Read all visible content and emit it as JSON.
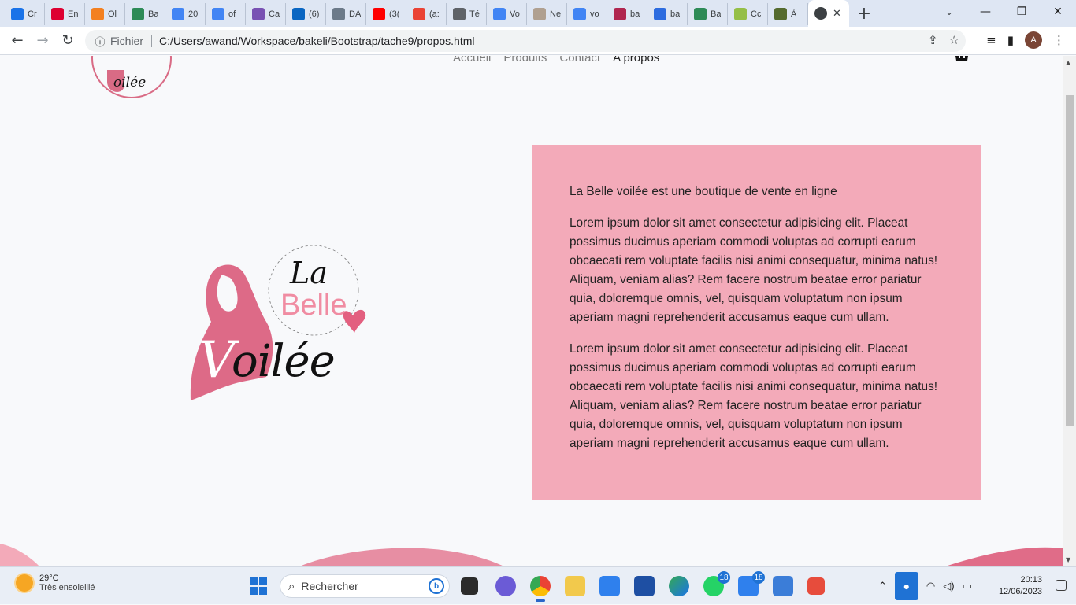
{
  "browser": {
    "tabs": [
      {
        "icon": "chrome-icon",
        "title": "Cr",
        "color": "#1a73e8"
      },
      {
        "icon": "angular-icon",
        "title": "En",
        "color": "#dd0031"
      },
      {
        "icon": "cloud-icon",
        "title": "Ol",
        "color": "#f38020"
      },
      {
        "icon": "bakeli-icon",
        "title": "Ba",
        "color": "#2e8b57"
      },
      {
        "icon": "docs-icon",
        "title": "20",
        "color": "#4285f4"
      },
      {
        "icon": "google-icon",
        "title": "of",
        "color": "#4285f4"
      },
      {
        "icon": "bootstrap-icon",
        "title": "Ca",
        "color": "#7952b3"
      },
      {
        "icon": "linkedin-icon",
        "title": "(6)",
        "color": "#0a66c2"
      },
      {
        "icon": "page-icon",
        "title": "DA",
        "color": "#6c7a89"
      },
      {
        "icon": "youtube-icon",
        "title": "(3(",
        "color": "#ff0000"
      },
      {
        "icon": "gmail-icon",
        "title": "(a:",
        "color": "#ea4335"
      },
      {
        "icon": "graduation-icon",
        "title": "Té",
        "color": "#5f6368"
      },
      {
        "icon": "google-icon",
        "title": "Vo",
        "color": "#4285f4"
      },
      {
        "icon": "notion-icon",
        "title": "Ne",
        "color": "#b0a090"
      },
      {
        "icon": "google-icon",
        "title": "vo",
        "color": "#4285f4"
      },
      {
        "icon": "tag-icon",
        "title": "ba",
        "color": "#b0264f"
      },
      {
        "icon": "wix-icon",
        "title": "ba",
        "color": "#2d6cdf"
      },
      {
        "icon": "bakeli-icon",
        "title": "Ba",
        "color": "#2e8b57"
      },
      {
        "icon": "shopify-icon",
        "title": "Cc",
        "color": "#95bf47"
      },
      {
        "icon": "tahe-icon",
        "title": "À",
        "color": "#556b2f"
      }
    ],
    "active_tab": {
      "icon": "globe-icon",
      "title": "",
      "close": "✕"
    },
    "new_tab": "+",
    "address": {
      "scheme_label": "Fichier",
      "url": "C:/Users/awand/Workspace/bakeli/Bootstrap/tache9/propos.html"
    },
    "profile_initial": "A"
  },
  "site": {
    "logo_small_text": "oilée",
    "nav": [
      {
        "label": "Accueil",
        "current": false
      },
      {
        "label": "Produits",
        "current": false
      },
      {
        "label": "Contact",
        "current": false
      },
      {
        "label": "A propos",
        "current": true
      }
    ],
    "big_logo": {
      "la": "La",
      "belle": "Belle",
      "v": "V",
      "oilee": "oilée"
    },
    "about": {
      "intro": "La Belle voilée est une boutique de vente en ligne",
      "paragraphs": [
        "Lorem ipsum dolor sit amet consectetur adipisicing elit. Placeat possimus ducimus aperiam commodi voluptas ad corrupti earum obcaecati rem voluptate facilis nisi animi consequatur, minima natus! Aliquam, veniam alias? Rem facere nostrum beatae error pariatur quia, doloremque omnis, vel, quisquam voluptatum non ipsum aperiam magni reprehenderit accusamus eaque cum ullam.",
        "Lorem ipsum dolor sit amet consectetur adipisicing elit. Placeat possimus ducimus aperiam commodi voluptas ad corrupti earum obcaecati rem voluptate facilis nisi animi consequatur, minima natus! Aliquam, veniam alias? Rem facere nostrum beatae error pariatur quia, doloremque omnis, vel, quisquam voluptatum non ipsum aperiam magni reprehenderit accusamus eaque cum ullam."
      ]
    },
    "colors": {
      "accent_pink": "#f3aab9",
      "logo_pink": "#d96b85",
      "belle_pink": "#f08ca2"
    }
  },
  "taskbar": {
    "weather": {
      "temp": "29°C",
      "desc": "Très ensoleillé"
    },
    "search_placeholder": "Rechercher",
    "whatsapp_badge": "18",
    "mail_badge": "18",
    "time": "20:13",
    "date": "12/06/2023"
  }
}
